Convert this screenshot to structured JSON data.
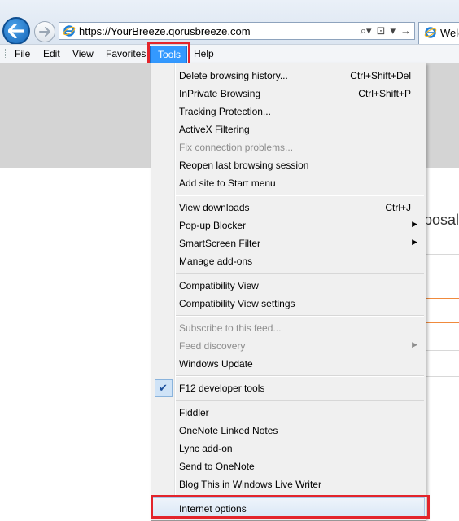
{
  "browser": {
    "address": "https://YourBreeze.qorusbreeze.com",
    "tab_title": "Welc",
    "address_icons": [
      "search-icon",
      "refresh-icon",
      "go-icon"
    ]
  },
  "menubar": {
    "items": [
      "File",
      "Edit",
      "View",
      "Favorites",
      "Tools",
      "Help"
    ],
    "active": "Tools"
  },
  "page": {
    "heading_fragment": "posal"
  },
  "tools_menu": {
    "groups": [
      [
        {
          "label": "Delete browsing history...",
          "shortcut": "Ctrl+Shift+Del"
        },
        {
          "label": "InPrivate Browsing",
          "shortcut": "Ctrl+Shift+P"
        },
        {
          "label": "Tracking Protection..."
        },
        {
          "label": "ActiveX Filtering"
        },
        {
          "label": "Fix connection problems...",
          "disabled": true
        },
        {
          "label": "Reopen last browsing session"
        },
        {
          "label": "Add site to Start menu"
        }
      ],
      [
        {
          "label": "View downloads",
          "shortcut": "Ctrl+J"
        },
        {
          "label": "Pop-up Blocker",
          "submenu": true
        },
        {
          "label": "SmartScreen Filter",
          "submenu": true
        },
        {
          "label": "Manage add-ons"
        }
      ],
      [
        {
          "label": "Compatibility View"
        },
        {
          "label": "Compatibility View settings"
        }
      ],
      [
        {
          "label": "Subscribe to this feed...",
          "disabled": true
        },
        {
          "label": "Feed discovery",
          "disabled": true,
          "submenu": true
        },
        {
          "label": "Windows Update"
        }
      ],
      [
        {
          "label": "F12 developer tools",
          "checked": true
        }
      ],
      [
        {
          "label": "Fiddler"
        },
        {
          "label": "OneNote Linked Notes"
        },
        {
          "label": "Lync add-on"
        },
        {
          "label": "Send to OneNote"
        },
        {
          "label": "Blog This in Windows Live Writer"
        }
      ],
      [
        {
          "label": "Internet options",
          "highlighted": true
        }
      ]
    ]
  },
  "colors": {
    "highlight_red": "#e3242b",
    "menu_active_blue": "#3399ff",
    "disabled_text": "#8d8d8d"
  }
}
